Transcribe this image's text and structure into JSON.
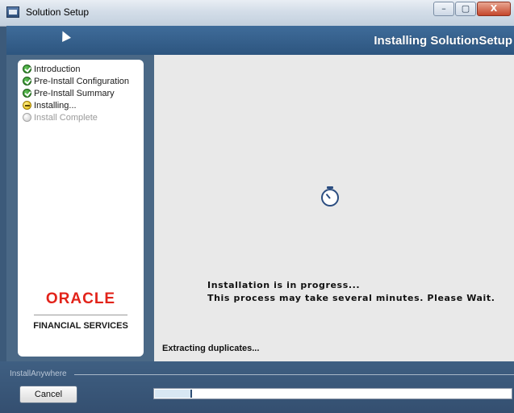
{
  "window": {
    "title": "Solution Setup",
    "controls": {
      "minimize": "–",
      "maximize": "▢",
      "close": "X"
    }
  },
  "header": {
    "title": "Installing SolutionSetup"
  },
  "steps": [
    {
      "label": "Introduction",
      "state": "done"
    },
    {
      "label": "Pre-Install Configuration",
      "state": "done"
    },
    {
      "label": "Pre-Install Summary",
      "state": "done"
    },
    {
      "label": "Installing...",
      "state": "current"
    },
    {
      "label": "Install Complete",
      "state": "pending"
    }
  ],
  "branding": {
    "logo": "ORACLE",
    "tagline": "FINANCIAL SERVICES"
  },
  "main": {
    "message_line1": "Installation is in progress...",
    "message_line2": "This process may take several minutes. Please Wait.",
    "status": "Extracting duplicates..."
  },
  "footer": {
    "installer_label": "InstallAnywhere",
    "cancel_label": "Cancel",
    "progress_fraction": 0.1
  },
  "colors": {
    "banner": "#3f6c9a",
    "logo": "#e2231a",
    "done_icon": "#1f7a1a",
    "current_icon": "#e0b400"
  }
}
